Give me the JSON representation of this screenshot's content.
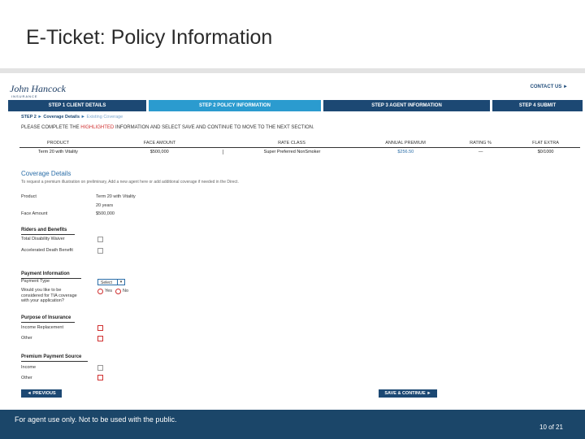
{
  "slide": {
    "title": "E-Ticket: Policy Information",
    "footer_note": "For agent use only. Not to be used with the public.",
    "page": "10 of 21"
  },
  "app": {
    "logo_text": "John Hancock",
    "logo_subtext": "INSURANCE",
    "contact_label": "CONTACT US ►"
  },
  "steps": [
    {
      "label": "STEP 1  CLIENT DETAILS",
      "active": false
    },
    {
      "label": "STEP 2  POLICY INFORMATION",
      "active": true
    },
    {
      "label": "STEP 3  AGENT INFORMATION",
      "active": false
    },
    {
      "label": "STEP 4  SUBMIT",
      "active": false
    }
  ],
  "breadcrumb": {
    "step": "STEP 2",
    "current": "Coverage Details",
    "next": "Existing Coverage"
  },
  "instructions": {
    "before": "PLEASE COMPLETE THE",
    "highlight": "HIGHLIGHTED",
    "after": "INFORMATION AND SELECT SAVE AND CONTINUE TO MOVE TO THE NEXT SECTION."
  },
  "policy_table": {
    "headers": [
      "PRODUCT",
      "FACE AMOUNT",
      "RATE CLASS",
      "ANNUAL PREMIUM",
      "RATING %",
      "FLAT EXTRA"
    ],
    "row": [
      "Term 20 with Vitality",
      "$500,000",
      "Super Preferred NonSmoker",
      "$256.50",
      "—",
      "$0/1000"
    ]
  },
  "coverage": {
    "title": "Coverage Details",
    "note": "To request a premium illustration on preliminary, Add a new agent here or add additional coverage if needed in the Direct.",
    "product_label": "Product",
    "product_value": "Term 20 with Vitality",
    "duration_value": "20 years",
    "face_amount_label": "Face Amount",
    "face_amount_value": "$500,000"
  },
  "riders": {
    "title": "Riders and Benefits",
    "items": [
      "Total Disability Waiver",
      "Accelerated Death Benefit"
    ]
  },
  "payment": {
    "title": "Payment Information",
    "payment_type_label": "Payment Type",
    "payment_type_value": "Select",
    "vitality_question": "Would you like to be considered for TIA coverage with your application?",
    "yes_label": "Yes",
    "no_label": "No"
  },
  "purpose": {
    "title": "Purpose of Insurance",
    "items": [
      "Income Replacement",
      "Other"
    ]
  },
  "premium_source": {
    "title": "Premium Payment Source",
    "items": [
      "Income",
      "Other"
    ]
  },
  "buttons": {
    "previous": "◄ PREVIOUS",
    "save_continue": "SAVE & CONTINUE ►"
  }
}
